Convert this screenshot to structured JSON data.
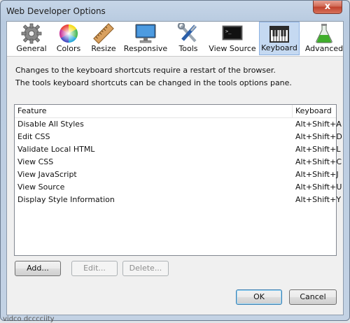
{
  "window": {
    "title": "Web Developer Options",
    "close_symbol": "x"
  },
  "toolbar": {
    "items": [
      {
        "label": "General",
        "icon": "gear-icon"
      },
      {
        "label": "Colors",
        "icon": "color-wheel-icon"
      },
      {
        "label": "Resize",
        "icon": "ruler-icon"
      },
      {
        "label": "Responsive",
        "icon": "monitor-icon"
      },
      {
        "label": "Tools",
        "icon": "tools-icon"
      },
      {
        "label": "View Source",
        "icon": "terminal-icon"
      },
      {
        "label": "Keyboard",
        "icon": "piano-keyboard-icon"
      },
      {
        "label": "Advanced",
        "icon": "flask-icon"
      }
    ],
    "selected": "Keyboard"
  },
  "info": {
    "line1": "Changes to the keyboard shortcuts require a restart of the browser.",
    "line2": "The tools keyboard shortcuts can be changed in the tools options pane."
  },
  "table": {
    "columns": [
      "Feature",
      "Keyboard"
    ],
    "rows": [
      {
        "feature": "Disable All Styles",
        "keyboard": "Alt+Shift+A"
      },
      {
        "feature": "Edit CSS",
        "keyboard": "Alt+Shift+D"
      },
      {
        "feature": "Validate Local HTML",
        "keyboard": "Alt+Shift+L"
      },
      {
        "feature": "View CSS",
        "keyboard": "Alt+Shift+C"
      },
      {
        "feature": "View JavaScript",
        "keyboard": "Alt+Shift+J"
      },
      {
        "feature": "View Source",
        "keyboard": "Alt+Shift+U"
      },
      {
        "feature": "Display Style Information",
        "keyboard": "Alt+Shift+Y"
      }
    ]
  },
  "buttons": {
    "add": "Add...",
    "edit": "Edit...",
    "delete": "Delete...",
    "ok": "OK",
    "cancel": "Cancel"
  },
  "background_peek": "vidco dcccciity"
}
